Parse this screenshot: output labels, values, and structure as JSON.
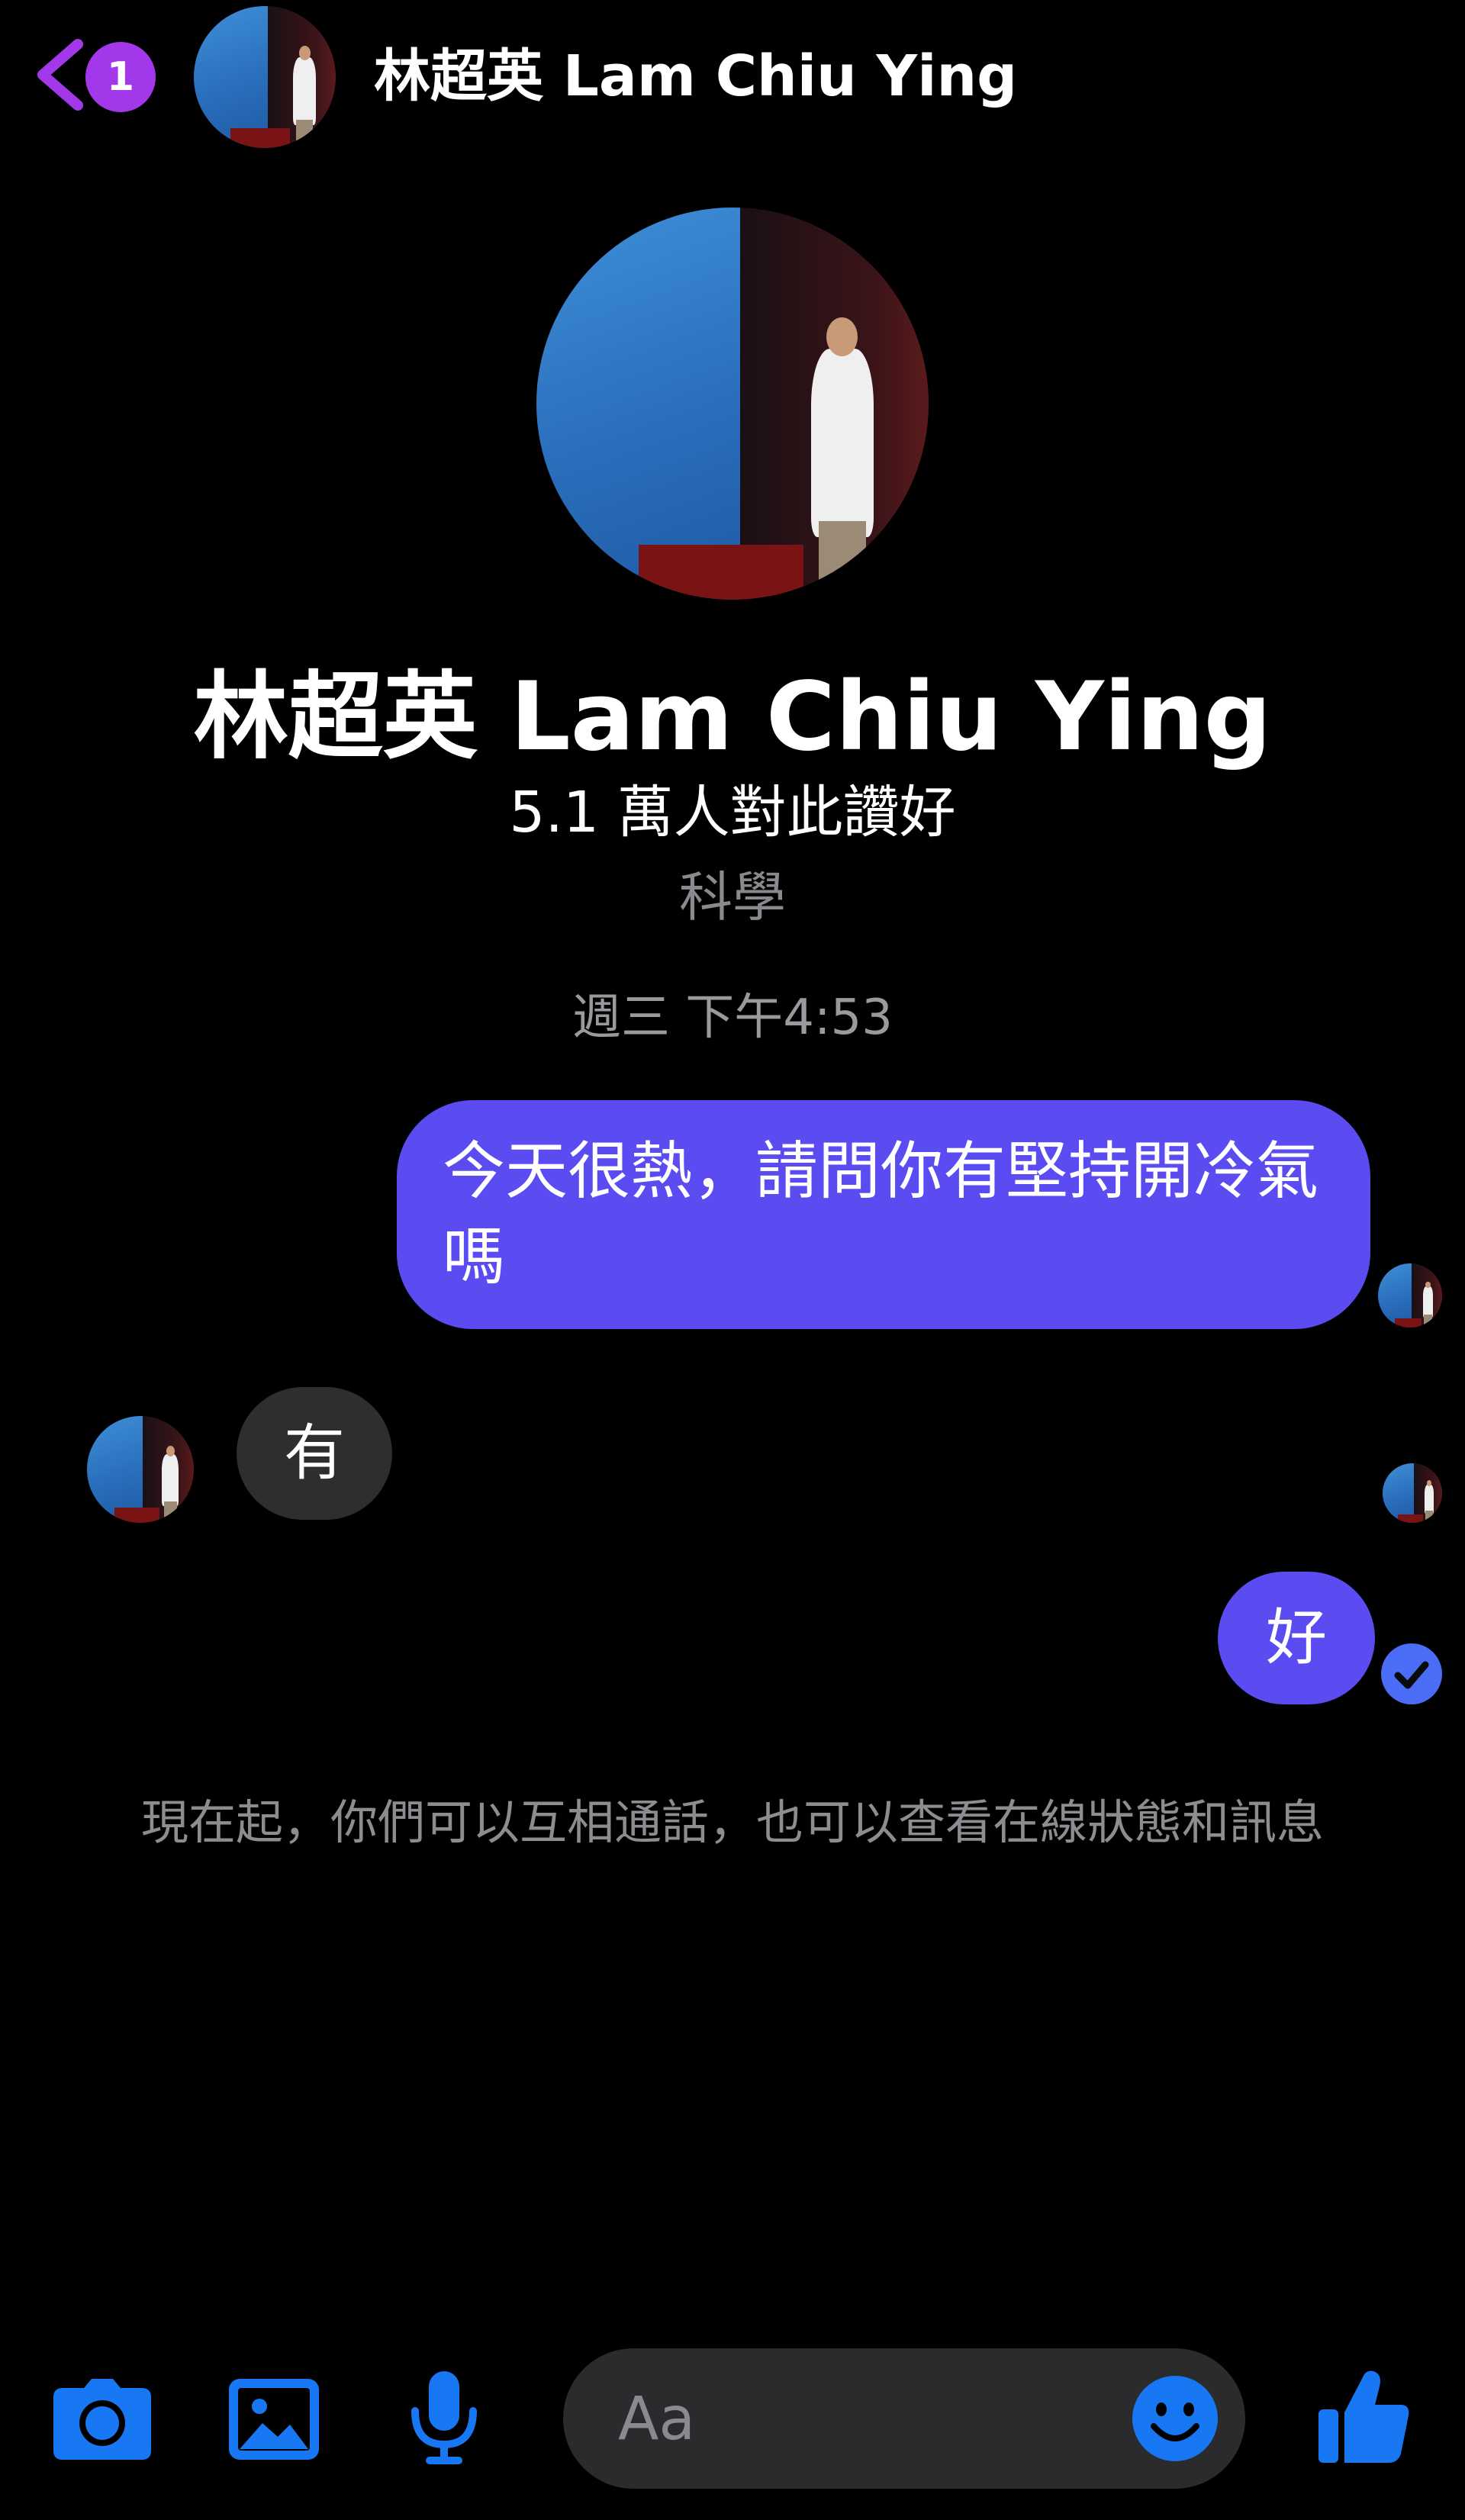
{
  "header": {
    "back_icon": "chevron-left-icon",
    "unread_count": "1",
    "title": "林超英 Lam Chiu Ying"
  },
  "profile": {
    "name": "林超英 Lam Chiu Ying",
    "likes": "5.1 萬人對此讚好",
    "category": "科學"
  },
  "conversation": {
    "timestamp": "週三 下午4:53",
    "messages": [
      {
        "direction": "outgoing",
        "text": "今天很熱，請問你有堅持開冷氣嗎"
      },
      {
        "direction": "incoming",
        "text": "有"
      },
      {
        "direction": "outgoing",
        "text": "好"
      }
    ],
    "system_notice": "現在起，你們可以互相通話，也可以查看在線狀態和訊息"
  },
  "composer": {
    "placeholder": "Aa",
    "icons": [
      "camera-icon",
      "photo-icon",
      "microphone-icon",
      "emoji-icon",
      "thumbs-up-icon"
    ]
  },
  "colors": {
    "accent": "#1877f2",
    "outgoing_bubble": "#5b4cf2",
    "incoming_bubble": "#2e2e30",
    "badge": "#a338ea",
    "back_chevron": "#a338ea",
    "background": "#000000"
  }
}
